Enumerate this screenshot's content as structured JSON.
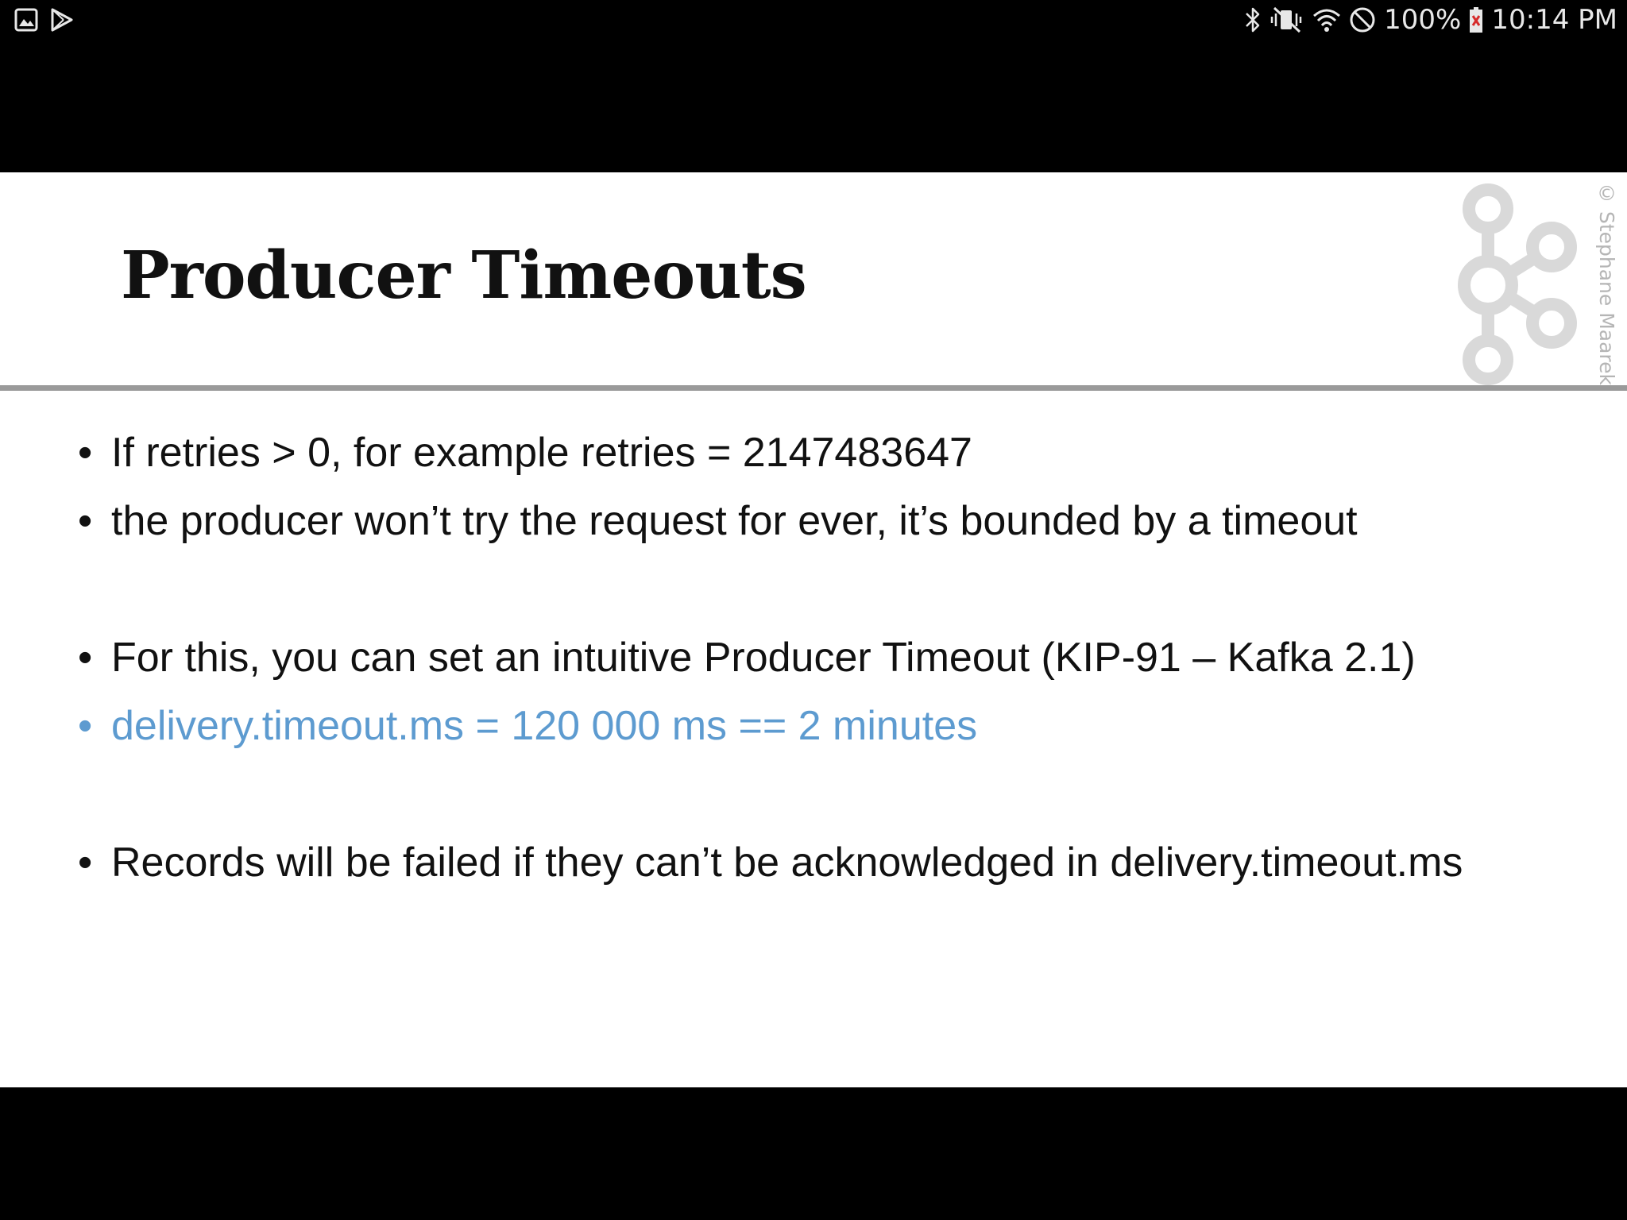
{
  "status_bar": {
    "left_icons": [
      "gallery-notification-icon",
      "play-store-notification-icon"
    ],
    "right_icons": [
      "bluetooth-icon",
      "vibrate-mute-icon",
      "wifi-icon",
      "do-not-disturb-icon",
      "battery-icon"
    ],
    "battery_percent": "100%",
    "time": "10:14 PM"
  },
  "slide": {
    "title": "Producer Timeouts",
    "watermark": "© Stephane Maarek",
    "logo_icon": "kafka-logo-icon",
    "bullets": [
      {
        "text": "If retries > 0, for example retries = 2147483647"
      },
      {
        "text": "the producer won’t try the request for ever, it’s bounded by a timeout"
      },
      {
        "text": "For this, you can set an intuitive Producer Timeout (KIP-91 – Kafka 2.1)"
      },
      {
        "text": "delivery.timeout.ms = 120 000 ms  == 2 minutes"
      },
      {
        "text": "Records will be failed if they can’t be acknowledged in delivery.timeout.ms"
      }
    ],
    "highlight_color": "#5d9bd0"
  }
}
